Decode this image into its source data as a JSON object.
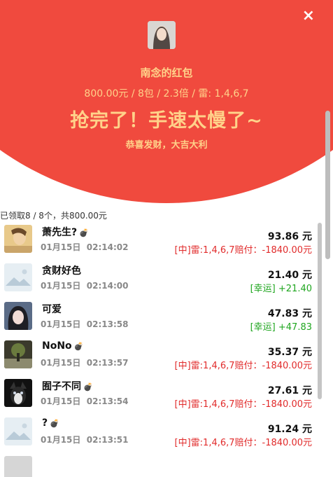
{
  "header": {
    "close_glyph": "×",
    "sender": "南念的红包",
    "info": "800.00元 / 8包 / 2.3倍 / 雷: 1,4,6,7",
    "headline": "抢完了！手速太慢了~",
    "blessing": "恭喜发财，大吉大利"
  },
  "summary": "已领取8 / 8个，共800.00元",
  "colors": {
    "header_red": "#f04a3e",
    "gold_text": "#ffd28a",
    "loss_red": "#e12b2b",
    "win_green": "#1fa61f"
  },
  "entries": [
    {
      "name": "萧先生?",
      "bomb": true,
      "date": "01月15日",
      "time": "02:14:02",
      "amount": "93.86 元",
      "result": "[中]雷:1,4,6,7赔付：-1840.00元",
      "result_type": "loss",
      "avatar": "photo-avatar"
    },
    {
      "name": "贪财好色",
      "bomb": false,
      "date": "01月15日",
      "time": "02:14:00",
      "amount": "21.40 元",
      "result": "[幸运] +21.40",
      "result_type": "win",
      "avatar": "placeholder-image"
    },
    {
      "name": "可爱",
      "bomb": false,
      "date": "01月15日",
      "time": "02:13:58",
      "amount": "47.83 元",
      "result": "[幸运] +47.83",
      "result_type": "win",
      "avatar": "photo-avatar"
    },
    {
      "name": "NoNo",
      "bomb": true,
      "date": "01月15日",
      "time": "02:13:57",
      "amount": "35.37 元",
      "result": "[中]雷:1,4,6,7赔付：-1840.00元",
      "result_type": "loss",
      "avatar": "photo-avatar"
    },
    {
      "name": "囿子不同",
      "bomb": true,
      "date": "01月15日",
      "time": "02:13:54",
      "amount": "27.61 元",
      "result": "[中]雷:1,4,6,7赔付：-1840.00元",
      "result_type": "loss",
      "avatar": "photo-avatar"
    },
    {
      "name": "?",
      "bomb": true,
      "date": "01月15日",
      "time": "02:13:51",
      "amount": "91.24 元",
      "result": "[中]雷:1,4,6,7赔付：-1840.00元",
      "result_type": "loss",
      "avatar": "placeholder-image"
    }
  ]
}
